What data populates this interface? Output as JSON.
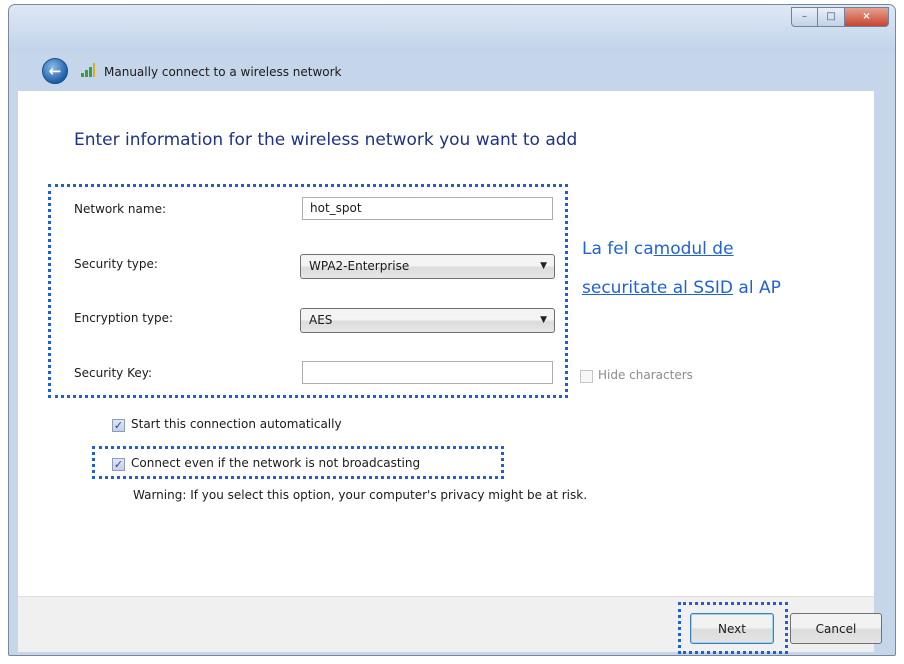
{
  "window": {
    "title": "Manually connect to a wireless network",
    "caption_buttons": {
      "minimize": "–",
      "maximize": "□",
      "close": "×"
    }
  },
  "heading": "Enter information for the wireless network you want to add",
  "form": {
    "network_name": {
      "label": "Network name:",
      "value": "hot_spot"
    },
    "security_type": {
      "label": "Security type:",
      "value": "WPA2-Enterprise"
    },
    "encryption_type": {
      "label": "Encryption type:",
      "value": "AES"
    },
    "security_key": {
      "label": "Security Key:",
      "value": ""
    },
    "hide_characters": {
      "label": "Hide characters",
      "checked": false,
      "enabled": false
    }
  },
  "options": {
    "start_automatically": {
      "label": "Start this connection automatically",
      "checked": true
    },
    "connect_if_not_broadcasting": {
      "label": "Connect even if the network is not broadcasting",
      "checked": true
    },
    "warning": "Warning: If you select this option, your computer's privacy might be at risk."
  },
  "annotation": {
    "prefix": "La fel ca",
    "link_part1": "modul de",
    "link_part2": "securitate al SSID",
    "suffix": " al AP"
  },
  "buttons": {
    "next": "Next",
    "cancel": "Cancel"
  },
  "colors": {
    "annotation": "#1f62d3",
    "heading": "#1e3287",
    "highlight_border": "#1c5fd6"
  }
}
